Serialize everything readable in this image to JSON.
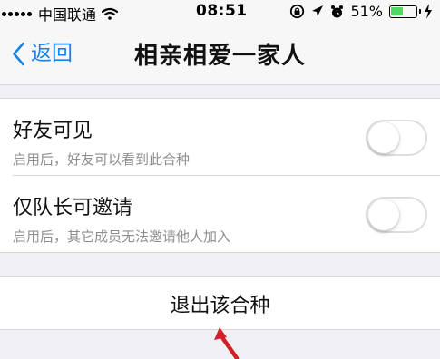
{
  "status_bar": {
    "carrier": "中国联通",
    "time": "08:51",
    "battery_percent": "51%",
    "battery_level": 0.51,
    "battery_color": "#4cd964"
  },
  "nav": {
    "back_label": "返回",
    "title": "相亲相爱一家人"
  },
  "settings": [
    {
      "title": "好友可见",
      "description": "启用后，好友可以看到此合种",
      "enabled": false
    },
    {
      "title": "仅队长可邀请",
      "description": "启用后，其它成员无法邀请他人加入",
      "enabled": false
    }
  ],
  "actions": {
    "leave_label": "退出该合种"
  },
  "colors": {
    "accent": "#1982e8",
    "arrow": "#d41f26",
    "background": "#efeff4"
  },
  "icons": {
    "back": "chevron-left-icon",
    "wifi": "wifi-icon",
    "lock_rotation": "rotation-lock-icon",
    "location": "location-arrow-icon",
    "alarm": "alarm-clock-icon",
    "battery": "battery-icon",
    "charging": "charging-bolt-icon",
    "annotation": "red-arrow-icon"
  }
}
